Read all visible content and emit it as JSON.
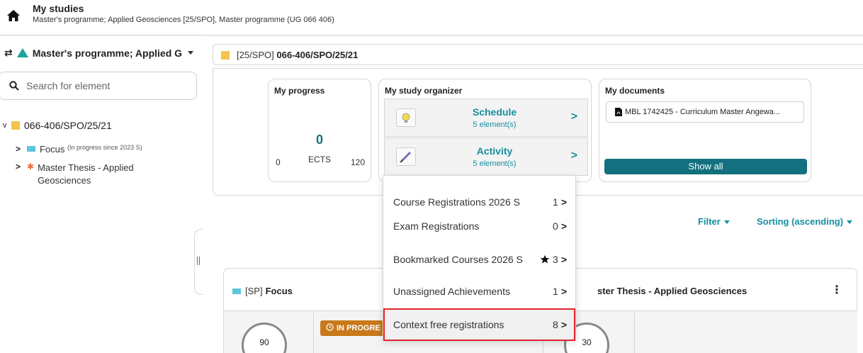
{
  "header": {
    "title": "My studies",
    "subtitle": "Master's programme; Applied Geosciences [25/SPO], Master programme (UG 066 406)"
  },
  "sidebar": {
    "programme_label": "Master's programme; Applied G",
    "search_placeholder": "Search for element",
    "tree_root": "066-406/SPO/25/21",
    "items": [
      {
        "label": "Focus",
        "note": "(In progress since 2023 S)"
      },
      {
        "label": "Master Thesis - Applied",
        "label2": "Geosciences"
      }
    ]
  },
  "main": {
    "head_prefix": "[25/SPO]",
    "head_code": "066-406/SPO/25/21",
    "progress": {
      "title": "My progress",
      "value": "0",
      "unit": "ECTS",
      "min": "0",
      "max": "120"
    },
    "organizer": {
      "title": "My study organizer",
      "rows": [
        {
          "name": "Schedule",
          "count": "5 element(s)"
        },
        {
          "name": "Activity",
          "count": "5 element(s)"
        }
      ]
    },
    "documents": {
      "title": "My documents",
      "item": "MBL 1742425 - Curriculum Master Angewa...",
      "show_all": "Show all"
    },
    "filter_label": "Filter",
    "sorting_label": "Sorting (ascending)",
    "focus_card": {
      "prefix": "[SP]",
      "label": "Focus",
      "status": "IN PROGRE",
      "ects": "90"
    },
    "thesis_card": {
      "label": "ster Thesis - Applied Geosciences",
      "ects": "30"
    }
  },
  "dropdown": {
    "items": [
      {
        "label": "Course Registrations 2026 S",
        "count": "1"
      },
      {
        "label": "Exam Registrations",
        "count": "0"
      },
      {
        "label": "Bookmarked Courses 2026 S",
        "count": "3"
      },
      {
        "label": "Unassigned Achievements",
        "count": "1"
      },
      {
        "label": "Context free registrations",
        "count": "8"
      }
    ]
  },
  "colors": {
    "accent": "#168f9e",
    "brand_dark": "#13707e",
    "highlight_border": "#e0242c",
    "status_in_progress": "#c9791b"
  }
}
